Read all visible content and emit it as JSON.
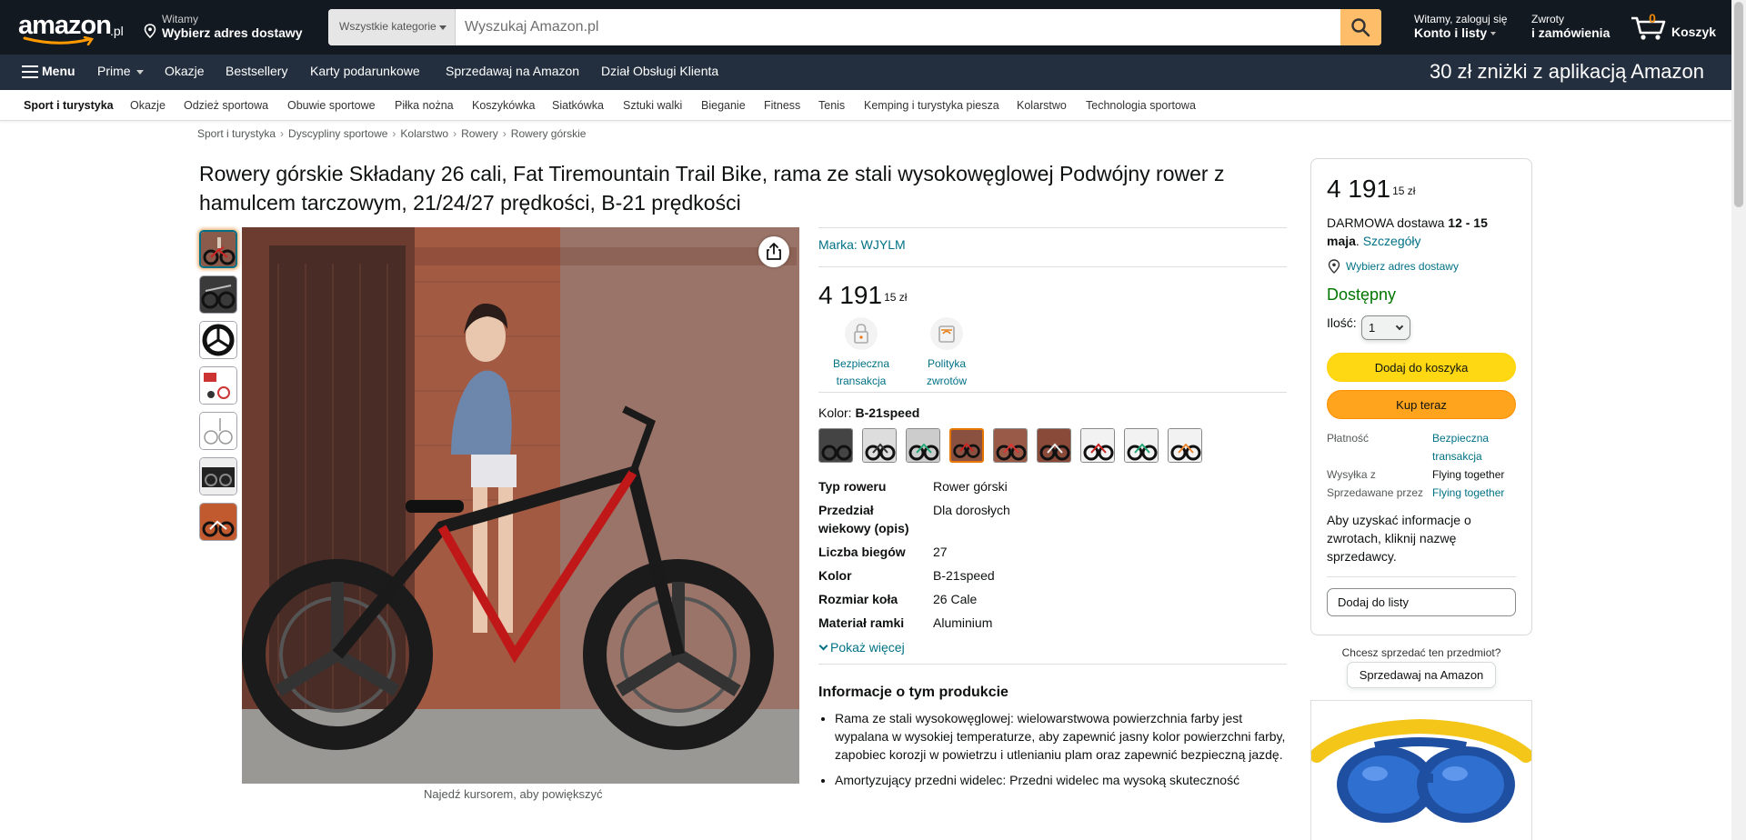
{
  "header": {
    "logo_text": "amazon",
    "logo_tld": ".pl",
    "deliver_line1": "Witamy",
    "deliver_line2": "Wybierz adres dostawy",
    "search_category": "Wszystkie kategorie",
    "search_placeholder": "Wyszukaj Amazon.pl",
    "account_line1": "Witamy, zaloguj się",
    "account_line2": "Konto i listy",
    "returns_line1": "Zwroty",
    "returns_line2": "i zamówienia",
    "cart_count": "0",
    "cart_label": "Koszyk"
  },
  "nav": {
    "menu_label": "Menu",
    "items": [
      "Prime",
      "Okazje",
      "Bestsellery",
      "Karty podarunkowe",
      "Sprzedawaj na Amazon",
      "Dział Obsługi Klienta"
    ],
    "promo": "30 zł zniżki z aplikacją Amazon"
  },
  "subnav": {
    "items": [
      "Sport i turystyka",
      "Okazje",
      "Odzież sportowa",
      "Obuwie sportowe",
      "Piłka nożna",
      "Koszykówka",
      "Siatkówka",
      "Sztuki walki",
      "Bieganie",
      "Fitness",
      "Tenis",
      "Kemping i turystyka piesza",
      "Kolarstwo",
      "Technologia sportowa"
    ]
  },
  "breadcrumb": [
    "Sport i turystyka",
    "Dyscypliny sportowe",
    "Kolarstwo",
    "Rowery",
    "Rowery górskie"
  ],
  "product": {
    "title": "Rowery górskie Składany 26 cali, Fat Tiremountain Trail Bike, rama ze stali wysokowęglowej Podwójny rower z hamulcem tarczowym, 21/24/27 prędkości, B-21 prędkości",
    "zoom_hint": "Najedź kursorem, aby powiększyć",
    "brand": "Marka: WJYLM",
    "price_whole": "4 191",
    "price_fraction": "15 zł",
    "badge_secure_line1": "Bezpieczna",
    "badge_secure_line2": "transakcja",
    "badge_returns_line1": "Polityka",
    "badge_returns_line2": "zwrotów",
    "color_label": "Kolor:",
    "color_value": "B-21speed",
    "specs": [
      {
        "k": "Typ roweru",
        "v": "Rower górski"
      },
      {
        "k": "Przedział wiekowy (opis)",
        "v": "Dla dorosłych"
      },
      {
        "k": "Liczba biegów",
        "v": "27"
      },
      {
        "k": "Kolor",
        "v": "B-21speed"
      },
      {
        "k": "Rozmiar koła",
        "v": "26 Cale"
      },
      {
        "k": "Materiał ramki",
        "v": "Aluminium"
      }
    ],
    "show_more": "Pokaż więcej",
    "about_title": "Informacje o tym produkcie",
    "bullets": [
      "Rama ze stali wysokowęglowej: wielowarstwowa powierzchnia farby jest wypalana w wysokiej temperaturze, aby zapewnić jasny kolor powierzchni farby, zapobiec korozji w powietrzu i utlenianiu plam oraz zapewnić bezpieczną jazdę.",
      "Amortyzujący przedni widelec: Przedni widelec ma wysoką skuteczność"
    ]
  },
  "buybox": {
    "price_whole": "4 191",
    "price_fraction": "15 zł",
    "delivery_prefix": "DARMOWA dostawa ",
    "delivery_dates": "12 - 15 maja",
    "delivery_link": "Szczegóły",
    "address_link": "Wybierz adres dostawy",
    "stock": "Dostępny",
    "qty_label": "Ilość:",
    "qty_value": "1",
    "add_to_cart": "Dodaj do koszyka",
    "buy_now": "Kup teraz",
    "rows": [
      {
        "k": "Płatność",
        "v": "Bezpieczna transakcja",
        "link": true
      },
      {
        "k": "Wysyłka z",
        "v": "Flying together",
        "link": false
      },
      {
        "k": "Sprzedawane przez",
        "v": "Flying together",
        "link": true
      }
    ],
    "returns_note": "Aby uzyskać informacje o zwrotach, kliknij nazwę sprzedawcy.",
    "add_to_list": "Dodaj do listy"
  },
  "sell": {
    "question": "Chcesz sprzedać ten przedmiot?",
    "button": "Sprzedawaj na Amazon"
  },
  "colors": {
    "nav_dark": "#131921",
    "nav_mid": "#232f3e",
    "search_button": "#febd69",
    "link": "#007185",
    "in_stock": "#007600",
    "add_to_cart": "#ffd814",
    "buy_now": "#ffa41c",
    "cart_count": "#f08804"
  }
}
